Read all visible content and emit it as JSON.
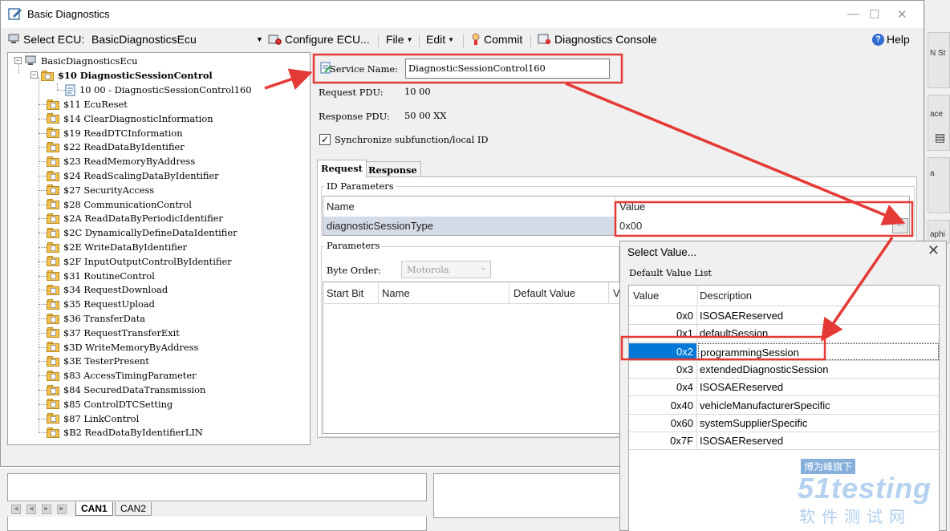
{
  "window": {
    "title": "Basic Diagnostics",
    "controls": [
      "—",
      "☐",
      "✕"
    ]
  },
  "toolbar": {
    "select_ecu_label": "Select ECU:",
    "select_ecu_value": "BasicDiagnosticsEcu",
    "configure_ecu": "Configure ECU...",
    "file": "File",
    "edit": "Edit",
    "commit": "Commit",
    "diagnostics_console": "Diagnostics Console",
    "help": "Help"
  },
  "tree": {
    "root": "BasicDiagnosticsEcu",
    "selected_service": "$10 DiagnosticSessionControl",
    "selected_child": "10 00 - DiagnosticSessionControl160",
    "services": [
      "$11 EcuReset",
      "$14 ClearDiagnosticInformation",
      "$19 ReadDTCInformation",
      "$22 ReadDataByIdentifier",
      "$23 ReadMemoryByAddress",
      "$24 ReadScalingDataByIdentifier",
      "$27 SecurityAccess",
      "$28 CommunicationControl",
      "$2A ReadDataByPeriodicIdentifier",
      "$2C DynamicallyDefineDataIdentifier",
      "$2E WriteDataByIdentifier",
      "$2F InputOutputControlByIdentifier",
      "$31 RoutineControl",
      "$34 RequestDownload",
      "$35 RequestUpload",
      "$36 TransferData",
      "$37 RequestTransferExit",
      "$3D WriteMemoryByAddress",
      "$3E TesterPresent",
      "$83 AccessTimingParameter",
      "$84 SecuredDataTransmission",
      "$85 ControlDTCSetting",
      "$87 LinkControl",
      "$B2 ReadDataByIdentifierLIN"
    ]
  },
  "service": {
    "name_label": "Service Name:",
    "name_value": "DiagnosticSessionControl160",
    "request_pdu_label": "Request PDU:",
    "request_pdu_value": "10 00",
    "response_pdu_label": "Response PDU:",
    "response_pdu_value": "50 00 XX",
    "sync_label": "Synchronize subfunction/local ID",
    "sync_checked": "✓"
  },
  "tabs": [
    "Request",
    "Response"
  ],
  "id_parameters": {
    "title": "ID Parameters",
    "headers": [
      "Name",
      "Value"
    ],
    "row": {
      "name": "diagnosticSessionType",
      "value": "0x00",
      "button": "..."
    }
  },
  "parameters": {
    "title": "Parameters",
    "byte_order_label": "Byte Order:",
    "byte_order_value": "Motorola",
    "headers": [
      "Start Bit",
      "Name",
      "Default Value",
      "V"
    ]
  },
  "bottom_tabs": [
    "CAN1",
    "CAN2"
  ],
  "dialog": {
    "title": "Select Value...",
    "subtitle": "Default Value List",
    "headers": [
      "Value",
      "Description"
    ],
    "rows": [
      {
        "value": "0x0",
        "description": "ISOSAEReserved"
      },
      {
        "value": "0x1",
        "description": "defaultSession"
      },
      {
        "value": "0x2",
        "description": "programmingSession"
      },
      {
        "value": "0x3",
        "description": "extendedDiagnosticSession"
      },
      {
        "value": "0x4",
        "description": "ISOSAEReserved"
      },
      {
        "value": "0x40",
        "description": "vehicleManufacturerSpecific"
      },
      {
        "value": "0x60",
        "description": "systemSupplierSpecific"
      },
      {
        "value": "0x7F",
        "description": "ISOSAEReserved"
      }
    ],
    "selected_value": "0x2"
  },
  "background_fragments": [
    "N St",
    "ace",
    "a",
    "aphi"
  ],
  "watermark": {
    "line1": "博为峰旗下",
    "line2": "51testing",
    "line3": "软件测试网"
  },
  "colors": {
    "annotation_red": "#e53935",
    "selection_blue": "#0078d7",
    "row_highlight": "#d4dbe6",
    "folder_yellow": "#f5c24a"
  }
}
